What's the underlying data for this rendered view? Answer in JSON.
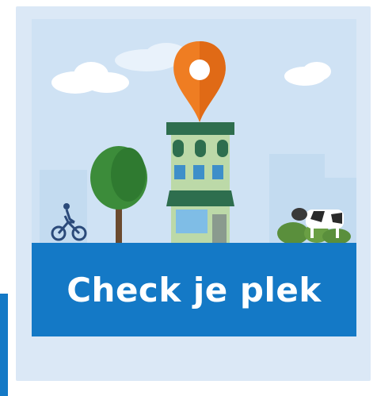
{
  "banner": {
    "text": "Check je plek"
  },
  "colors": {
    "banner_blue": "#1479c6",
    "tile_background": "#dbe8f6",
    "pin_orange": "#ef7d22",
    "building_green": "#2e6e4e",
    "tree_green": "#3c8c3a"
  },
  "icons": {
    "pin": "location-pin-icon",
    "cyclist": "cyclist-icon",
    "cow": "cow-icon"
  }
}
